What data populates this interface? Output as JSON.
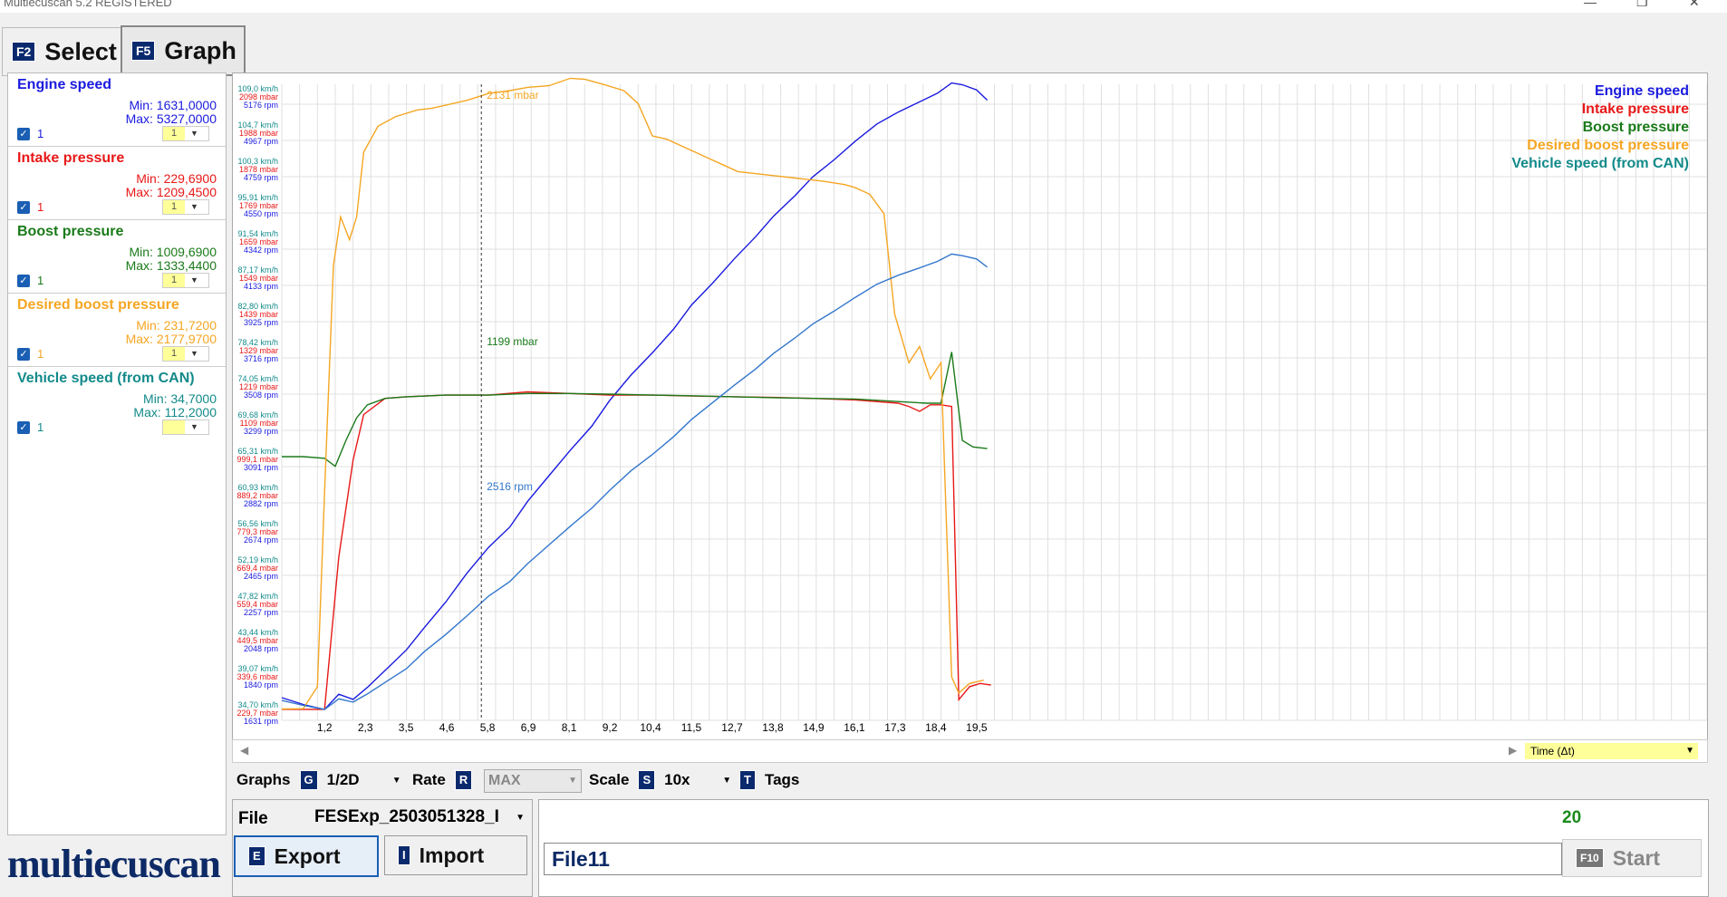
{
  "window": {
    "title": "Multiecuscan 5.2 REGISTERED"
  },
  "tabs": [
    {
      "key": "F2",
      "label": "Select"
    },
    {
      "key": "F5",
      "label": "Graph"
    }
  ],
  "signals": [
    {
      "name": "Engine speed",
      "min": "Min: 1631,0000",
      "max": "Max: 5327,0000",
      "count": "1",
      "scale": "1",
      "color": "#1a1adf"
    },
    {
      "name": "Intake pressure",
      "min": "Min: 229,6900",
      "max": "Max: 1209,4500",
      "count": "1",
      "scale": "1",
      "color": "#e81818"
    },
    {
      "name": "Boost pressure",
      "min": "Min: 1009,6900",
      "max": "Max: 1333,4400",
      "count": "1",
      "scale": "1",
      "color": "#1a7a1a"
    },
    {
      "name": "Desired boost pressure",
      "min": "Min: 231,7200",
      "max": "Max: 2177,9700",
      "count": "1",
      "scale": "1",
      "color": "#f5a623"
    },
    {
      "name": "Vehicle speed (from CAN)",
      "min": "Min: 34,7000",
      "max": "Max: 112,2000",
      "count": "1",
      "scale": "",
      "color": "#138a8a"
    }
  ],
  "legend": [
    "Engine speed",
    "Intake pressure",
    "Boost pressure",
    "Desired boost pressure",
    "Vehicle speed (from CAN)"
  ],
  "chart_data": {
    "type": "line",
    "xlabel": "Time (Δt)",
    "x_ticks": [
      "1,2",
      "2,3",
      "3,5",
      "4,6",
      "5,8",
      "6,9",
      "8,1",
      "9,2",
      "10,4",
      "11,5",
      "12,7",
      "13,8",
      "14,9",
      "16,1",
      "17,3",
      "18,4",
      "19,5"
    ],
    "y_tick_groups": [
      [
        "109,0 km/h",
        "2098 mbar",
        "5176 rpm"
      ],
      [
        "104,7 km/h",
        "1988 mbar",
        "4967 rpm"
      ],
      [
        "100,3 km/h",
        "1878 mbar",
        "4759 rpm"
      ],
      [
        "95,91 km/h",
        "1769 mbar",
        "4550 rpm"
      ],
      [
        "91,54 km/h",
        "1659 mbar",
        "4342 rpm"
      ],
      [
        "87,17 km/h",
        "1549 mbar",
        "4133 rpm"
      ],
      [
        "82,80 km/h",
        "1439 mbar",
        "3925 rpm"
      ],
      [
        "78,42 km/h",
        "1329 mbar",
        "3716 rpm"
      ],
      [
        "74,05 km/h",
        "1219 mbar",
        "3508 rpm"
      ],
      [
        "69,68 km/h",
        "1109 mbar",
        "3299 rpm"
      ],
      [
        "65,31 km/h",
        "999,1 mbar",
        "3091 rpm"
      ],
      [
        "60,93 km/h",
        "889,2 mbar",
        "2882 rpm"
      ],
      [
        "56,56 km/h",
        "779,3 mbar",
        "2674 rpm"
      ],
      [
        "52,19 km/h",
        "669,4 mbar",
        "2465 rpm"
      ],
      [
        "47,82 km/h",
        "559,4 mbar",
        "2257 rpm"
      ],
      [
        "43,44 km/h",
        "449,5 mbar",
        "2048 rpm"
      ],
      [
        "39,07 km/h",
        "339,6 mbar",
        "1840 rpm"
      ],
      [
        "34,70 km/h",
        "229,7 mbar",
        "1631 rpm"
      ]
    ],
    "annotations": [
      "2131 mbar",
      "1199 mbar",
      "2516 rpm"
    ],
    "cursor_x": 5.6,
    "x_range": [
      0,
      40
    ],
    "grid": true,
    "legend_position": "top-right",
    "series": [
      {
        "name": "Engine speed",
        "color": "#1a1adf",
        "unit": "rpm",
        "y_range": [
          1631,
          5176
        ],
        "x": [
          0,
          0.6,
          1.2,
          1.6,
          2.0,
          2.4,
          3.0,
          3.5,
          4.0,
          4.6,
          5.2,
          5.8,
          6.4,
          6.9,
          7.5,
          8.1,
          8.7,
          9.2,
          9.8,
          10.4,
          11.0,
          11.5,
          12.1,
          12.7,
          13.3,
          13.8,
          14.4,
          14.9,
          15.5,
          16.1,
          16.7,
          17.3,
          17.9,
          18.4,
          18.8,
          19.1,
          19.5,
          19.8
        ],
        "y": [
          1700,
          1660,
          1631,
          1720,
          1690,
          1760,
          1880,
          1980,
          2110,
          2260,
          2430,
          2580,
          2700,
          2850,
          3000,
          3150,
          3290,
          3440,
          3590,
          3720,
          3860,
          4000,
          4130,
          4270,
          4400,
          4520,
          4640,
          4750,
          4850,
          4960,
          5060,
          5130,
          5190,
          5240,
          5300,
          5290,
          5260,
          5200
        ]
      },
      {
        "name": "Intake pressure",
        "color": "#e81818",
        "unit": "mbar",
        "y_range": [
          229.7,
          2098
        ],
        "x": [
          0,
          0.8,
          1.2,
          1.6,
          2.0,
          2.3,
          2.9,
          3.5,
          4.6,
          5.8,
          6.9,
          8.1,
          9.2,
          10.4,
          11.5,
          12.7,
          13.8,
          14.9,
          16.1,
          17.3,
          17.6,
          17.9,
          18.2,
          18.5,
          18.8,
          19.0,
          19.3,
          19.6,
          19.9
        ],
        "y": [
          230,
          230,
          230,
          700,
          1000,
          1140,
          1190,
          1195,
          1200,
          1200,
          1210,
          1205,
          1200,
          1200,
          1197,
          1195,
          1193,
          1190,
          1185,
          1175,
          1165,
          1150,
          1170,
          1170,
          1165,
          260,
          300,
          310,
          305
        ]
      },
      {
        "name": "Boost pressure",
        "color": "#1a7a1a",
        "unit": "mbar",
        "y_range": [
          229.7,
          2098
        ],
        "x": [
          0,
          0.6,
          1.2,
          1.5,
          1.8,
          2.1,
          2.4,
          2.9,
          3.5,
          4.6,
          5.8,
          6.9,
          8.1,
          9.2,
          10.4,
          11.5,
          12.7,
          13.8,
          14.9,
          16.1,
          17.3,
          18.1,
          18.5,
          18.8,
          19.1,
          19.4,
          19.8
        ],
        "y": [
          1010,
          1010,
          1005,
          980,
          1060,
          1130,
          1170,
          1190,
          1195,
          1200,
          1200,
          1205,
          1205,
          1203,
          1200,
          1198,
          1195,
          1192,
          1190,
          1188,
          1180,
          1175,
          1175,
          1333,
          1060,
          1040,
          1035
        ]
      },
      {
        "name": "Desired boost pressure",
        "color": "#f5a623",
        "unit": "mbar",
        "y_range": [
          229.7,
          2098
        ],
        "x": [
          0,
          0.6,
          1.0,
          1.2,
          1.45,
          1.65,
          1.9,
          2.1,
          2.3,
          2.7,
          3.2,
          3.8,
          4.2,
          4.6,
          5.2,
          5.8,
          6.4,
          6.9,
          7.5,
          8.1,
          8.5,
          9.0,
          9.6,
          10.0,
          10.4,
          10.8,
          11.2,
          11.6,
          12.0,
          12.4,
          12.8,
          13.6,
          14.4,
          15.2,
          15.8,
          16.1,
          16.5,
          16.9,
          17.2,
          17.6,
          17.9,
          18.2,
          18.5,
          18.8,
          19.0,
          19.3,
          19.7
        ],
        "y": [
          231,
          232,
          300,
          900,
          1600,
          1750,
          1680,
          1750,
          1950,
          2030,
          2060,
          2080,
          2085,
          2095,
          2110,
          2131,
          2140,
          2150,
          2155,
          2178,
          2175,
          2160,
          2140,
          2100,
          2000,
          1990,
          1970,
          1950,
          1930,
          1910,
          1890,
          1880,
          1870,
          1860,
          1850,
          1840,
          1820,
          1760,
          1450,
          1300,
          1350,
          1250,
          1300,
          330,
          280,
          310,
          320
        ]
      },
      {
        "name": "Vehicle speed (from CAN)",
        "color": "#3377cc",
        "unit": "km/h",
        "y_range": [
          34.7,
          109.0
        ],
        "x": [
          0,
          0.6,
          1.2,
          1.6,
          2.0,
          2.4,
          3.0,
          3.5,
          4.0,
          4.6,
          5.2,
          5.8,
          6.4,
          6.9,
          7.5,
          8.1,
          8.7,
          9.2,
          9.8,
          10.4,
          11.0,
          11.5,
          12.1,
          12.7,
          13.3,
          13.8,
          14.4,
          14.9,
          15.5,
          16.1,
          16.7,
          17.3,
          17.9,
          18.4,
          18.8,
          19.1,
          19.5,
          19.8
        ],
        "y": [
          35.8,
          35.2,
          34.7,
          36.0,
          35.6,
          36.6,
          38.3,
          39.7,
          41.8,
          43.9,
          46.2,
          48.6,
          50.4,
          52.6,
          54.9,
          57.2,
          59.4,
          61.6,
          64.0,
          66.0,
          68.2,
          70.3,
          72.4,
          74.5,
          76.5,
          78.4,
          80.3,
          82.0,
          83.6,
          85.3,
          86.9,
          88.0,
          88.9,
          89.7,
          90.6,
          90.4,
          90.0,
          89.0
        ]
      }
    ]
  },
  "controls": {
    "graphs_label": "Graphs",
    "graphs_key": "G",
    "graphs_value": "1/2D",
    "rate_label": "Rate",
    "rate_key": "R",
    "rate_value": "MAX",
    "scale_label": "Scale",
    "scale_key": "S",
    "scale_value": "10x",
    "tags_key": "T",
    "tags_label": "Tags"
  },
  "file": {
    "label": "File",
    "value": "FESExp_2503051328_I",
    "export_key": "E",
    "export_label": "Export",
    "import_key": "I",
    "import_label": "Import",
    "name_field": "File11",
    "count": "20",
    "start_key": "F10",
    "start_label": "Start"
  },
  "logo": "multiecuscan"
}
